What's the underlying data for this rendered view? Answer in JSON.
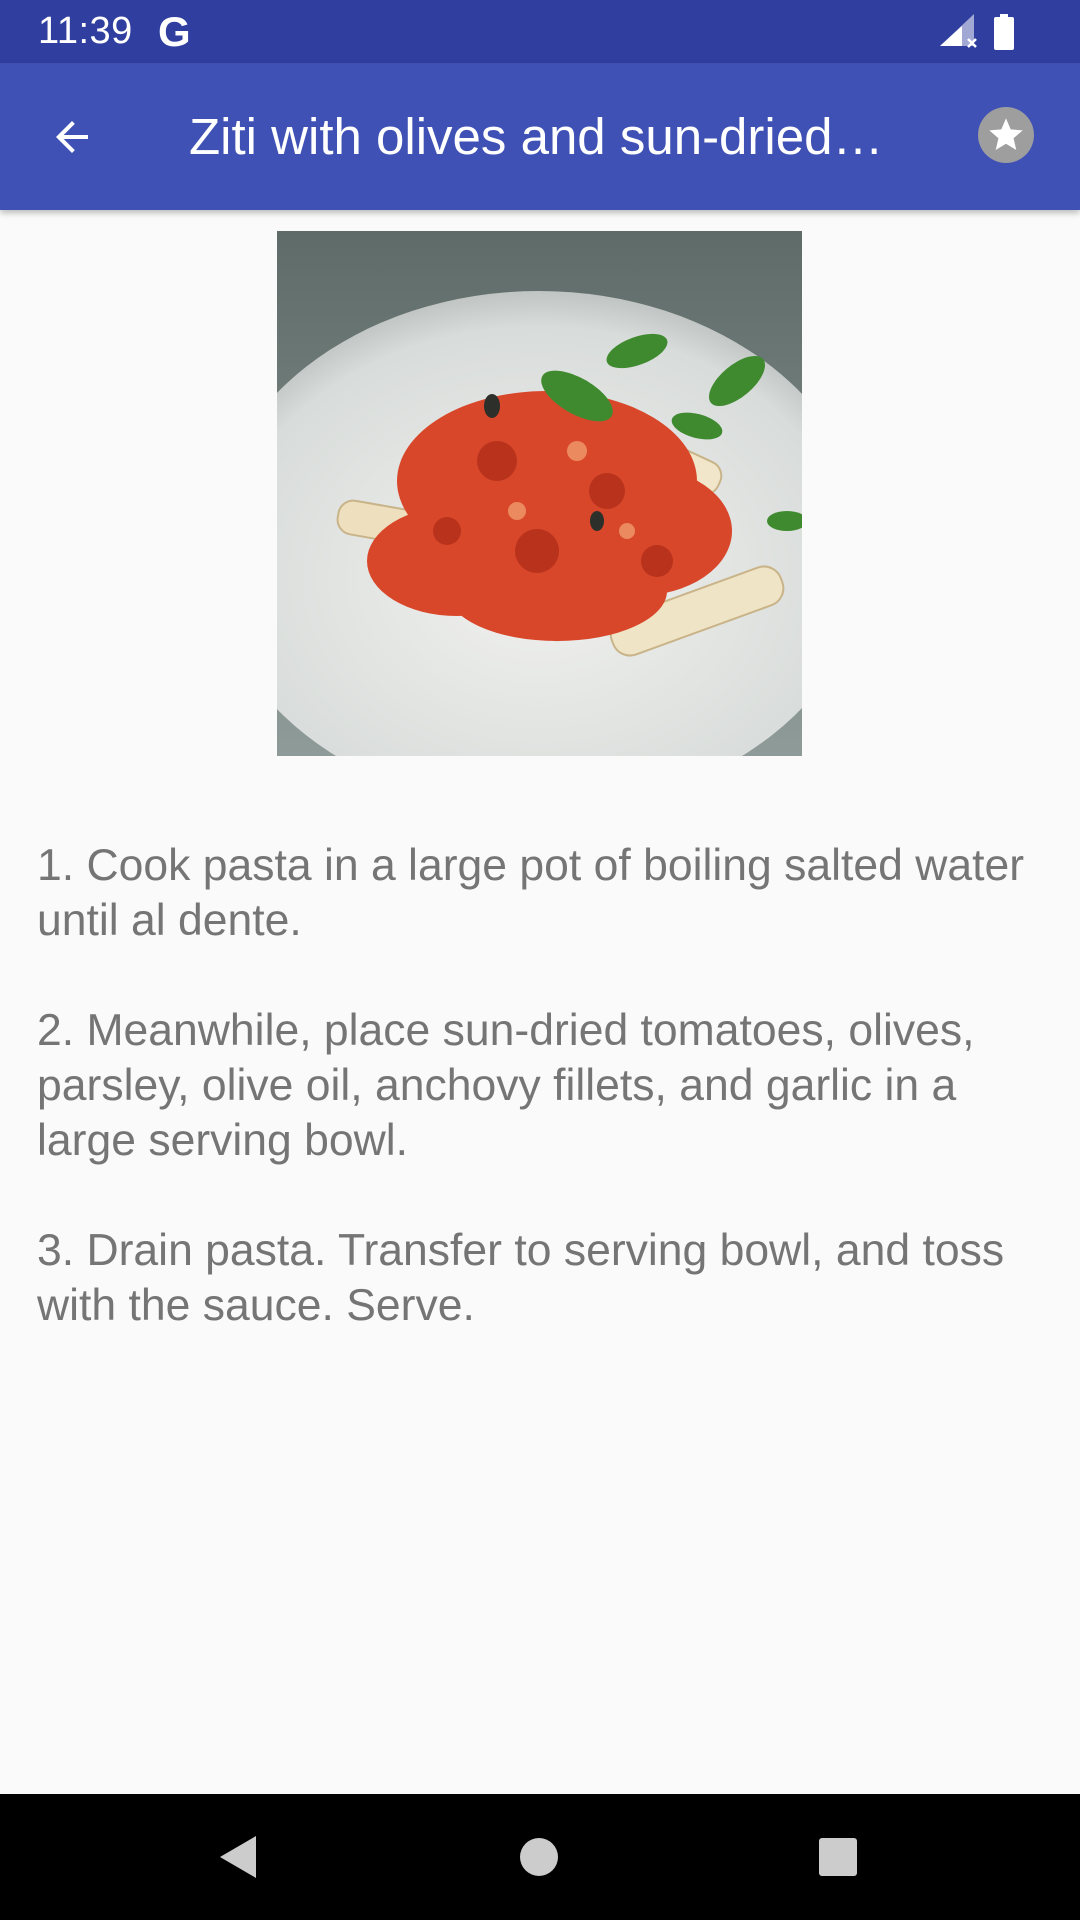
{
  "status_bar": {
    "time": "11:39",
    "google_badge": "G",
    "icons": [
      "signal-icon",
      "battery-icon"
    ]
  },
  "app_bar": {
    "title": "Ziti with olives and sun-dried…",
    "back_icon": "arrow-back-icon",
    "favorite_icon": "star-icon"
  },
  "recipe": {
    "photo_subject": "ziti pasta dish image",
    "steps": [
      "1. Cook pasta in a large pot of boiling salted water until al dente.",
      "2. Meanwhile, place sun-dried tomatoes, olives, parsley, olive oil, anchovy fillets, and garlic in a large serving bowl.",
      "3. Drain pasta. Transfer to serving bowl, and toss with the sauce. Serve."
    ]
  },
  "nav_bar": {
    "buttons": [
      "back-triangle-icon",
      "home-circle-icon",
      "recents-square-icon"
    ]
  },
  "colors": {
    "status_bar": "#303f9f",
    "app_bar": "#3f51b5",
    "background": "#fafafa",
    "body_text": "#757575"
  }
}
